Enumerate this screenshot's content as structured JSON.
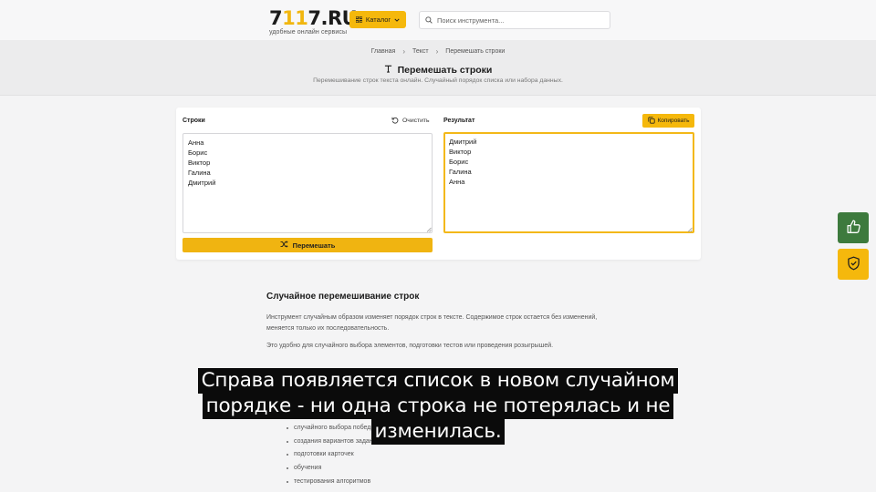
{
  "header": {
    "logo_prefix": "7",
    "logo_accent": "11",
    "logo_suffix": "7.RU",
    "logo_tagline": "удобные онлайн сервисы",
    "catalog_label": "Каталог",
    "search_placeholder": "Поиск инструмента..."
  },
  "breadcrumb": [
    "Главная",
    "Текст",
    "Перемешать строки"
  ],
  "page": {
    "title": "Перемешать строки",
    "subtitle": "Перемешивание строк текста онлайн. Случайный порядок списка или набора данных."
  },
  "tool": {
    "input_label": "Строки",
    "clear_label": "Очистить",
    "input_value": "Анна\nБорис\nВиктор\nГалина\nДмитрий",
    "result_label": "Результат",
    "copy_label": "Копировать",
    "result_value": "Дмитрий\nВиктор\nБорис\nГалина\nАнна",
    "shuffle_label": "Перемешать"
  },
  "article": {
    "heading": "Случайное перемешивание строк",
    "p1_line1": "Инструмент случайным образом изменяет порядок строк в тексте. Содержимое строк остается без изменений,",
    "p1_line2": "меняется только их последовательность.",
    "p2": "Это удобно для случайного выбора элементов, подготовки тестов или проведения розыгрышей.",
    "list": [
      "случайного выбора победите",
      "создания вариантов задани",
      "подготовки карточек",
      "обучения",
      "тестирования алгоритмов"
    ]
  },
  "caption": {
    "line1": "Справа появляется список в новом случайном",
    "line2": "порядке - ни одна строка не потерялась и не",
    "line3": "изменилась."
  },
  "colors": {
    "accent": "#f5b80c",
    "like_button": "#3d7a3d",
    "text": "#1b1b1b"
  }
}
